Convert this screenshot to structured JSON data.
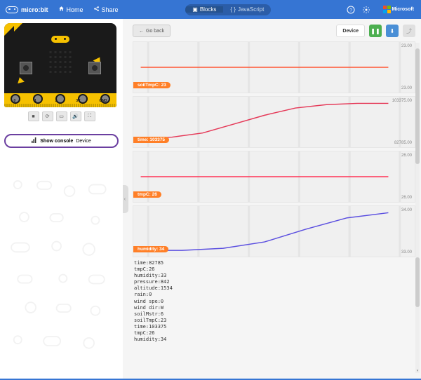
{
  "header": {
    "brand": "micro:bit",
    "home": "Home",
    "share": "Share",
    "tabs": {
      "blocks": "Blocks",
      "js": "JavaScript"
    },
    "microsoft": "Microsoft"
  },
  "sim": {
    "pin_labels": [
      "0",
      "1",
      "2",
      "3V",
      "GND"
    ],
    "controls": [
      "stop",
      "refresh",
      "open",
      "audio",
      "fullscreen"
    ]
  },
  "console_button": {
    "pre": "Show console",
    "suf": "Device"
  },
  "right": {
    "goback": "Go back",
    "device": "Device"
  },
  "chart_data": [
    {
      "name": "soilTmpC",
      "badge": "soilTmpC: 23",
      "color": "#ff5533",
      "value": 23,
      "ymax": "23.00",
      "ymin": "23.00",
      "type": "line",
      "series": [
        0.5,
        0.5,
        0.5,
        0.5,
        0.5,
        0.5,
        0.5
      ]
    },
    {
      "name": "time",
      "badge": "time: 103375",
      "color": "#e53958",
      "value": 103375,
      "ymax": "103375.00",
      "ymin": "82785.00",
      "type": "line",
      "series": [
        0.9,
        0.86,
        0.76,
        0.55,
        0.34,
        0.17,
        0.09,
        0.06,
        0.06
      ]
    },
    {
      "name": "tmpC",
      "badge": "tmpC: 26",
      "color": "#ff3355",
      "value": 26,
      "ymax": "26.00",
      "ymin": "26.00",
      "type": "line",
      "series": [
        0.5,
        0.5,
        0.5,
        0.5,
        0.5,
        0.5,
        0.5
      ]
    },
    {
      "name": "humidity",
      "badge": "humidity: 34",
      "color": "#5b4fe0",
      "value": 34,
      "ymax": "34.00",
      "ymin": "33.00",
      "type": "line",
      "series": [
        0.95,
        0.95,
        0.9,
        0.75,
        0.45,
        0.18,
        0.06
      ]
    }
  ],
  "console_output": "time:82785\ntmpC:26\nhumidity:33\npressure:842\naltitude:1534\nrain:0\nwind spe:0\nwind dir:W\nsoilMstr:6\nsoilTmpC:23\ntime:103375\ntmpC:26\nhumidity:34"
}
